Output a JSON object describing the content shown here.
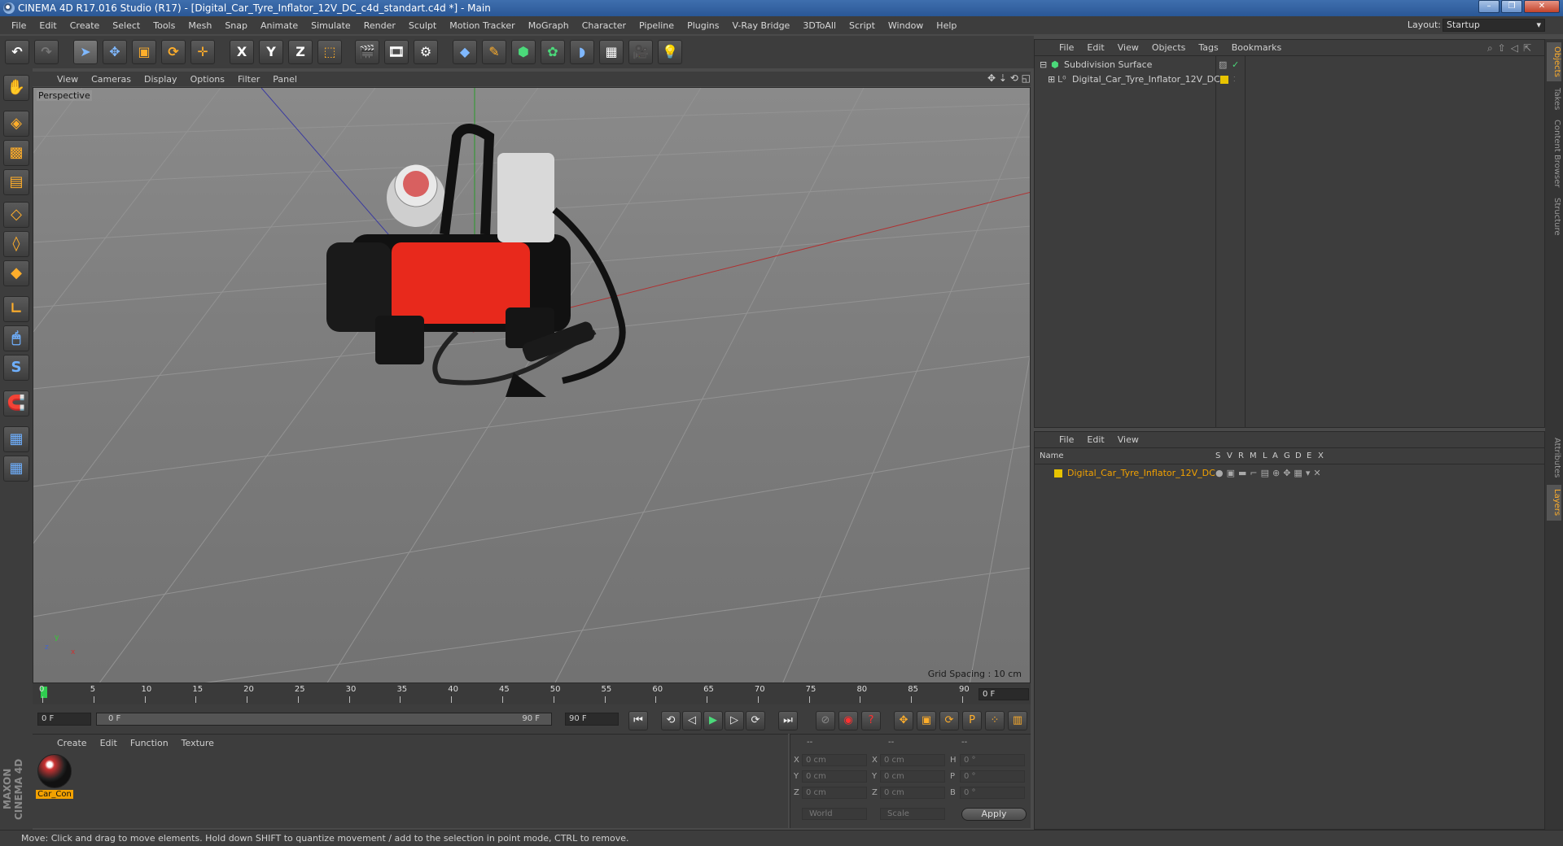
{
  "window": {
    "title": "CINEMA 4D R17.016 Studio (R17) - [Digital_Car_Tyre_Inflator_12V_DC_c4d_standart.c4d *] - Main",
    "controls": [
      "–",
      "❐",
      "✕"
    ]
  },
  "menubar": {
    "items": [
      "File",
      "Edit",
      "Create",
      "Select",
      "Tools",
      "Mesh",
      "Snap",
      "Animate",
      "Simulate",
      "Render",
      "Sculpt",
      "Motion Tracker",
      "MoGraph",
      "Character",
      "Pipeline",
      "Plugins",
      "V-Ray Bridge",
      "3DToAll",
      "Script",
      "Window",
      "Help"
    ],
    "layout_label": "Layout:",
    "layout_value": "Startup"
  },
  "toolbar": {
    "undo": "↶",
    "redo": "↷",
    "x_axis": "X",
    "y_axis": "Y",
    "z_axis": "Z"
  },
  "viewport": {
    "menu": [
      "View",
      "Cameras",
      "Display",
      "Options",
      "Filter",
      "Panel"
    ],
    "camera_label": "Perspective",
    "grid_spacing": "Grid Spacing : 10 cm",
    "nav_icons": "✥ ⇣ ⟲ ◱",
    "axis_y": "y",
    "axis_z": "z",
    "axis_x": "x"
  },
  "timeline": {
    "ticks": [
      "0",
      "5",
      "10",
      "15",
      "20",
      "25",
      "30",
      "35",
      "40",
      "45",
      "50",
      "55",
      "60",
      "65",
      "70",
      "75",
      "80",
      "85",
      "90"
    ],
    "current_frame_field": "0 F",
    "start_field": "0 F",
    "range_start": "0 F",
    "range_end": "90 F",
    "end_field": "90 F"
  },
  "materials": {
    "menu": [
      "Create",
      "Edit",
      "Function",
      "Texture"
    ],
    "items": [
      {
        "name": "Car_Con"
      }
    ]
  },
  "coordinates": {
    "headers": [
      "--",
      "--",
      "--"
    ],
    "rows": [
      {
        "l1": "X",
        "v1": "0 cm",
        "l2": "X",
        "v2": "0 cm",
        "l3": "H",
        "v3": "0 °"
      },
      {
        "l1": "Y",
        "v1": "0 cm",
        "l2": "Y",
        "v2": "0 cm",
        "l3": "P",
        "v3": "0 °"
      },
      {
        "l1": "Z",
        "v1": "0 cm",
        "l2": "Z",
        "v2": "0 cm",
        "l3": "B",
        "v3": "0 °"
      }
    ],
    "mode_world": "World",
    "mode_scale": "Scale",
    "apply": "Apply"
  },
  "objects": {
    "menu": [
      "File",
      "Edit",
      "View",
      "Objects",
      "Tags",
      "Bookmarks"
    ],
    "rows": [
      {
        "name": "Subdivision Surface"
      },
      {
        "name": "Digital_Car_Tyre_Inflator_12V_DC"
      }
    ]
  },
  "layers": {
    "menu": [
      "File",
      "Edit",
      "View"
    ],
    "name_header": "Name",
    "columns": [
      "S",
      "V",
      "R",
      "M",
      "L",
      "A",
      "G",
      "D",
      "E",
      "X"
    ],
    "rows": [
      {
        "name": "Digital_Car_Tyre_Inflator_12V_DC",
        "color": "#e8c400"
      }
    ]
  },
  "right_tabs": [
    "Objects",
    "Takes",
    "Content Browser",
    "Structure",
    "Attributes",
    "Layers"
  ],
  "brand": "MAXON CINEMA 4D",
  "status": "Move: Click and drag to move elements. Hold down SHIFT to quantize movement / add to the selection in point mode, CTRL to remove.",
  "colors": {
    "accent": "#ffae2b",
    "layer_yellow": "#e8c400",
    "model_red": "#e8291c"
  }
}
